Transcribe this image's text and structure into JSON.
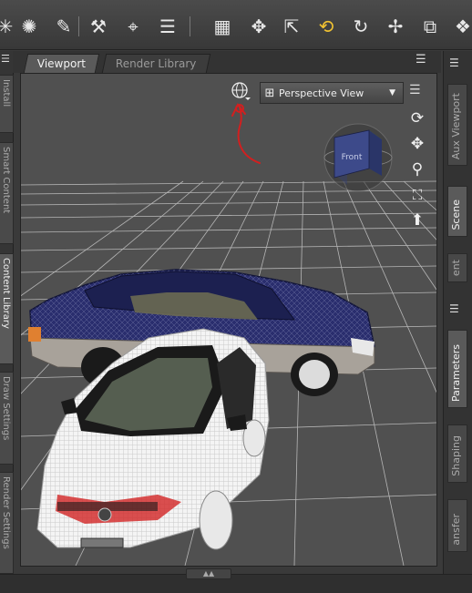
{
  "toolbar": {
    "tools": [
      {
        "name": "joint-editor-icon"
      },
      {
        "name": "node-weight-icon"
      },
      {
        "name": "geometry-editor-icon"
      },
      {
        "name": "transform-icon"
      },
      {
        "name": "align-icon"
      },
      {
        "name": "render-settings-icon"
      },
      {
        "name": "universal-tool-icon"
      },
      {
        "name": "node-selection-icon"
      },
      {
        "name": "active-pose-icon"
      },
      {
        "name": "rotate-icon"
      },
      {
        "name": "translate-icon"
      },
      {
        "name": "scale-icon"
      },
      {
        "name": "surface-selection-icon"
      }
    ]
  },
  "left_tabs": [
    {
      "label": "Install"
    },
    {
      "label": "Smart Content"
    },
    {
      "label": "Content Library"
    },
    {
      "label": "Draw Settings"
    },
    {
      "label": "Render Settings"
    }
  ],
  "viewport_tabs": [
    {
      "label": "Viewport",
      "active": true
    },
    {
      "label": "Render Library",
      "active": false
    }
  ],
  "viewport": {
    "camera_select": "Perspective View",
    "view_cube_label": "Front",
    "nav_icons": [
      "orbit-icon",
      "pan-icon",
      "zoom-icon",
      "frame-icon",
      "bowl-icon"
    ]
  },
  "right_tabs_top": [
    {
      "label": "Aux Viewport",
      "active": false
    },
    {
      "label": "Scene",
      "active": true
    },
    {
      "label": "ent",
      "active": false
    }
  ],
  "right_tabs_bottom": [
    {
      "label": "Parameters",
      "active": true
    },
    {
      "label": "Shaping",
      "active": false
    },
    {
      "label": "ansfer",
      "active": false
    }
  ],
  "colors": {
    "viewport_bg": "#505050",
    "grid": "#c8c8c8",
    "navy_car": "#2a2e6e",
    "white_car": "#f4f4f4",
    "annotation": "#d21f1f",
    "view_cube": "#3d4a8a"
  }
}
